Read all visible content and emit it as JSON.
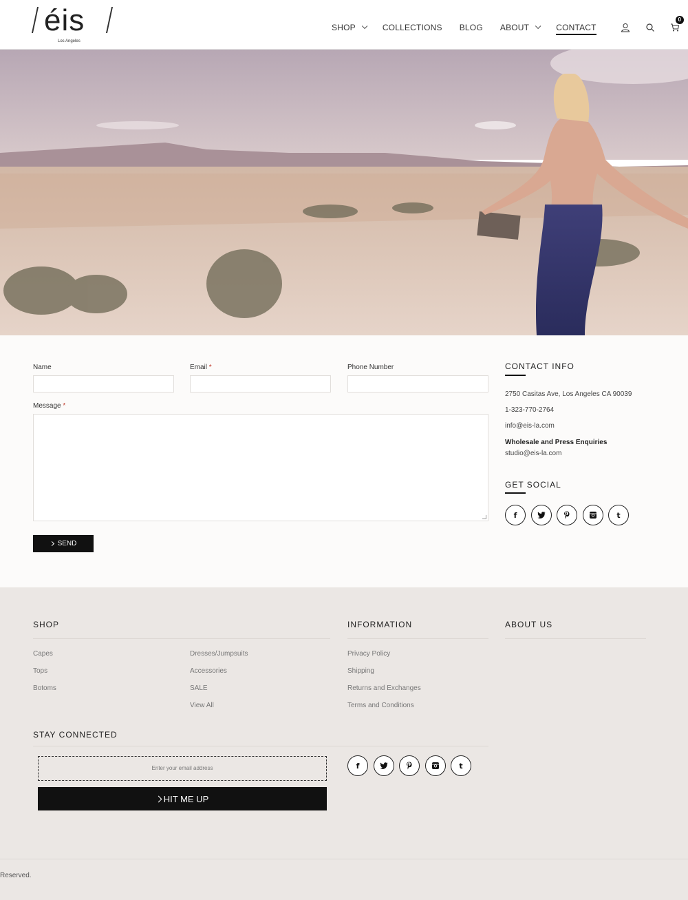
{
  "brand": {
    "name": "éis",
    "tagline": "Los Angeles"
  },
  "nav": {
    "items": [
      {
        "label": "SHOP",
        "dropdown": true
      },
      {
        "label": "COLLECTIONS",
        "dropdown": false
      },
      {
        "label": "BLOG",
        "dropdown": false
      },
      {
        "label": "ABOUT",
        "dropdown": true
      },
      {
        "label": "CONTACT",
        "dropdown": false,
        "active": true
      }
    ],
    "icons": [
      "user-icon",
      "search-icon",
      "cart-icon"
    ],
    "cart_count": "0"
  },
  "form": {
    "name_label": "Name",
    "email_label": "Email",
    "phone_label": "Phone Number",
    "message_label": "Message",
    "required_mark": "*",
    "send_label": "SEND"
  },
  "contact_info": {
    "title": "CONTACT INFO",
    "address": "2750 Casitas Ave, Los Angeles CA 90039",
    "phone": "1-323-770-2764",
    "email": "info@eis-la.com",
    "wholesale_title": "Wholesale and Press Enquiries",
    "wholesale_email": "studio@eis-la.com",
    "social_title": "GET SOCIAL"
  },
  "social": [
    "facebook-icon",
    "twitter-icon",
    "pinterest-icon",
    "instagram-icon",
    "tumblr-icon"
  ],
  "footer": {
    "shop_title": "SHOP",
    "shop_col1": [
      "Capes",
      "Tops",
      "Botoms"
    ],
    "shop_col2": [
      "Dresses/Jumpsuits",
      "Accessories",
      "SALE",
      "View All"
    ],
    "info_title": "INFORMATION",
    "info_links": [
      "Privacy Policy",
      "Shipping",
      "Returns and Exchanges",
      "Terms and Conditions"
    ],
    "about_title": "ABOUT US",
    "stay_title": "STAY CONNECTED",
    "email_placeholder": "Enter your email address",
    "hit_label": "HIT ME UP",
    "copyright": "Reserved."
  },
  "colors": {
    "accent": "#111111",
    "footer_bg": "#ebe7e4",
    "contact_bg": "#fcfbfa"
  }
}
